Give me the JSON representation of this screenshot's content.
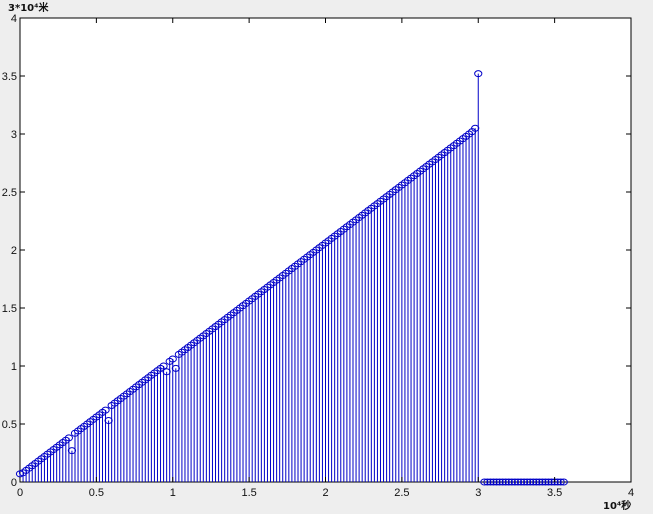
{
  "chart_data": {
    "type": "stem",
    "title": "",
    "xlabel": "10⁴秒",
    "ylabel": "3*10⁴米",
    "xlim": [
      0,
      4
    ],
    "ylim": [
      0,
      4
    ],
    "xticks": [
      0,
      0.5,
      1,
      1.5,
      2,
      2.5,
      3,
      3.5,
      4
    ],
    "yticks": [
      0,
      0.5,
      1,
      1.5,
      2,
      2.5,
      3,
      3.5,
      4
    ],
    "xtick_labels": [
      "0",
      "0.5",
      "1",
      "1.5",
      "2",
      "2.5",
      "3",
      "3.5",
      "4"
    ],
    "ytick_labels": [
      "0",
      "0.5",
      "1",
      "1.5",
      "2",
      "2.5",
      "3",
      "3.5",
      "4"
    ],
    "grid": false,
    "series": [
      {
        "color": "#0000c8",
        "marker": "circle",
        "x": [
          0.0,
          0.02,
          0.04,
          0.06,
          0.08,
          0.1,
          0.12,
          0.14,
          0.16,
          0.18,
          0.2,
          0.22,
          0.24,
          0.26,
          0.28,
          0.3,
          0.32,
          0.34,
          0.36,
          0.38,
          0.4,
          0.42,
          0.44,
          0.46,
          0.48,
          0.5,
          0.52,
          0.54,
          0.56,
          0.58,
          0.6,
          0.62,
          0.64,
          0.66,
          0.68,
          0.7,
          0.72,
          0.74,
          0.76,
          0.78,
          0.8,
          0.82,
          0.84,
          0.86,
          0.88,
          0.9,
          0.92,
          0.94,
          0.96,
          0.98,
          1.0,
          1.02,
          1.04,
          1.06,
          1.08,
          1.1,
          1.12,
          1.14,
          1.16,
          1.18,
          1.2,
          1.22,
          1.24,
          1.26,
          1.28,
          1.3,
          1.32,
          1.34,
          1.36,
          1.38,
          1.4,
          1.42,
          1.44,
          1.46,
          1.48,
          1.5,
          1.52,
          1.54,
          1.56,
          1.58,
          1.6,
          1.62,
          1.64,
          1.66,
          1.68,
          1.7,
          1.72,
          1.74,
          1.76,
          1.78,
          1.8,
          1.82,
          1.84,
          1.86,
          1.88,
          1.9,
          1.92,
          1.94,
          1.96,
          1.98,
          2.0,
          2.02,
          2.04,
          2.06,
          2.08,
          2.1,
          2.12,
          2.14,
          2.16,
          2.18,
          2.2,
          2.22,
          2.24,
          2.26,
          2.28,
          2.3,
          2.32,
          2.34,
          2.36,
          2.38,
          2.4,
          2.42,
          2.44,
          2.46,
          2.48,
          2.5,
          2.52,
          2.54,
          2.56,
          2.58,
          2.6,
          2.62,
          2.64,
          2.66,
          2.68,
          2.7,
          2.72,
          2.74,
          2.76,
          2.78,
          2.8,
          2.82,
          2.84,
          2.86,
          2.88,
          2.9,
          2.92,
          2.94,
          2.96,
          2.98,
          3.0,
          3.04,
          3.06,
          3.08,
          3.1,
          3.12,
          3.14,
          3.16,
          3.18,
          3.2,
          3.22,
          3.24,
          3.26,
          3.28,
          3.3,
          3.32,
          3.34,
          3.36,
          3.38,
          3.4,
          3.42,
          3.44,
          3.46,
          3.48,
          3.5,
          3.52,
          3.54,
          3.56
        ],
        "y": [
          0.07,
          0.08,
          0.1,
          0.12,
          0.14,
          0.16,
          0.18,
          0.2,
          0.22,
          0.24,
          0.26,
          0.28,
          0.3,
          0.32,
          0.34,
          0.36,
          0.38,
          0.27,
          0.42,
          0.44,
          0.46,
          0.48,
          0.5,
          0.52,
          0.54,
          0.56,
          0.58,
          0.6,
          0.62,
          0.53,
          0.66,
          0.68,
          0.7,
          0.72,
          0.74,
          0.76,
          0.78,
          0.8,
          0.82,
          0.84,
          0.86,
          0.88,
          0.9,
          0.92,
          0.94,
          0.96,
          0.98,
          1.0,
          0.95,
          1.04,
          1.06,
          0.98,
          1.1,
          1.12,
          1.14,
          1.16,
          1.18,
          1.2,
          1.22,
          1.24,
          1.26,
          1.28,
          1.3,
          1.32,
          1.34,
          1.36,
          1.38,
          1.4,
          1.42,
          1.44,
          1.46,
          1.48,
          1.5,
          1.52,
          1.54,
          1.56,
          1.58,
          1.6,
          1.62,
          1.64,
          1.66,
          1.68,
          1.7,
          1.72,
          1.74,
          1.76,
          1.78,
          1.8,
          1.82,
          1.84,
          1.86,
          1.88,
          1.9,
          1.92,
          1.94,
          1.96,
          1.98,
          2.0,
          2.02,
          2.04,
          2.06,
          2.08,
          2.1,
          2.12,
          2.14,
          2.16,
          2.18,
          2.2,
          2.22,
          2.24,
          2.26,
          2.28,
          2.3,
          2.32,
          2.34,
          2.36,
          2.38,
          2.4,
          2.42,
          2.44,
          2.46,
          2.48,
          2.5,
          2.52,
          2.54,
          2.56,
          2.58,
          2.6,
          2.62,
          2.64,
          2.66,
          2.68,
          2.7,
          2.72,
          2.74,
          2.76,
          2.78,
          2.8,
          2.82,
          2.84,
          2.86,
          2.88,
          2.9,
          2.92,
          2.94,
          2.96,
          2.98,
          3.0,
          3.02,
          3.05,
          3.52,
          0,
          0,
          0,
          0,
          0,
          0,
          0,
          0,
          0,
          0,
          0,
          0,
          0,
          0,
          0,
          0,
          0,
          0,
          0,
          0,
          0,
          0,
          0,
          0,
          0,
          0,
          0
        ]
      }
    ]
  }
}
